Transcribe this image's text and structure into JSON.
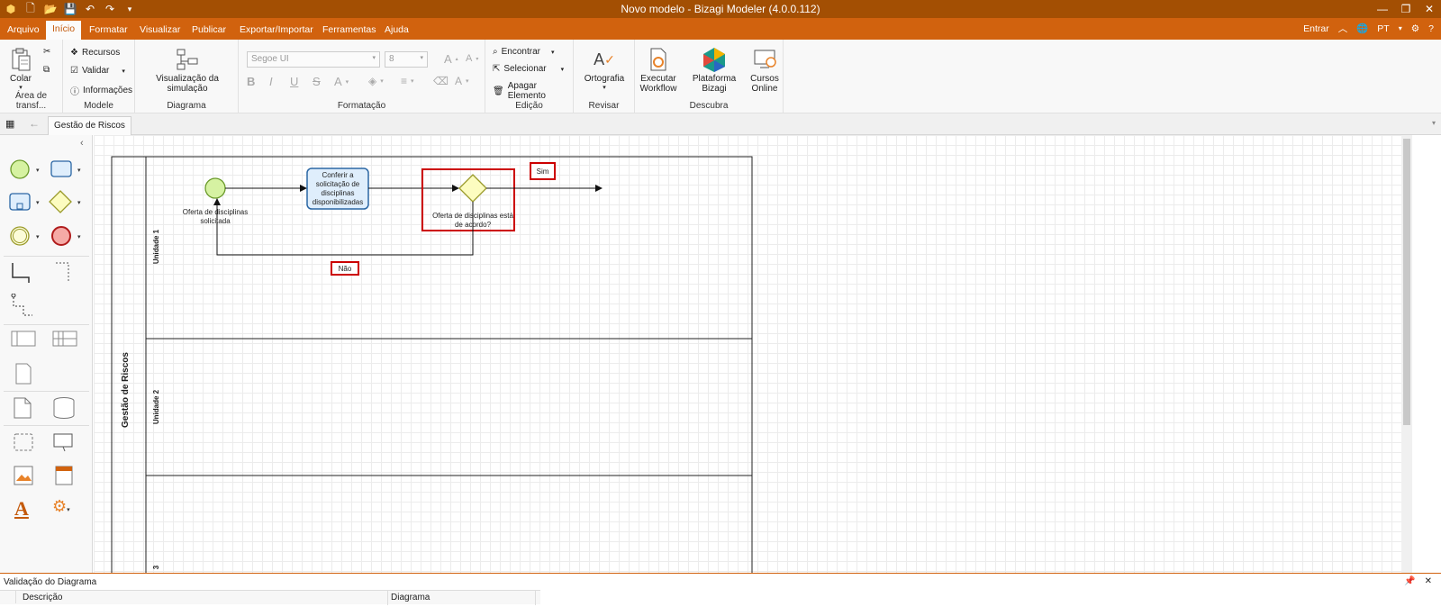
{
  "window": {
    "title": "Novo modelo - Bizagi Modeler (4.0.0.112)"
  },
  "tabs": [
    "Arquivo",
    "Início",
    "Formatar",
    "Visualizar",
    "Publicar",
    "Exportar/Importar",
    "Ferramentas",
    "Ajuda"
  ],
  "account": {
    "login": "Entrar",
    "language": "PT"
  },
  "ribbon": {
    "clipboard": {
      "paste": "Colar",
      "label": "Área de transf..."
    },
    "model": {
      "resources": "Recursos",
      "validate": "Validar",
      "info": "Informações",
      "label": "Modele"
    },
    "diagram": {
      "sim_view": "Visualização da simulação",
      "label": "Diagrama"
    },
    "format": {
      "font": "Segoe UI",
      "size": "8",
      "label": "Formatação"
    },
    "edit": {
      "find": "Encontrar",
      "select": "Selecionar",
      "delete": "Apagar Elemento",
      "label": "Edição"
    },
    "review": {
      "spelling": "Ortografia",
      "label": "Revisar"
    },
    "discover": {
      "run1": "Executar",
      "run2": "Workflow",
      "platform": "Plataforma Bizagi",
      "courses1": "Cursos",
      "courses2": "Online",
      "label": "Descubra"
    }
  },
  "doc_tab": "Gestão de Riscos",
  "diagram": {
    "pool": "Gestão de Riscos",
    "lanes": [
      "Unidade 1",
      "Unidade 2",
      "3"
    ],
    "start_event": "Oferta de disciplinas solicitada",
    "task": "Conferir a solicitação de disciplinas disponibilizadas",
    "gateway": "Oferta de disciplinas está de acordo?",
    "yes": "Sim",
    "no": "Não"
  },
  "validation": {
    "title": "Validação do Diagrama",
    "col_desc": "Descrição",
    "col_diag": "Diagrama"
  },
  "colors": {
    "titlebar": "#a34f03",
    "tabbar": "#d1620e",
    "highlight": "#cc0000"
  }
}
